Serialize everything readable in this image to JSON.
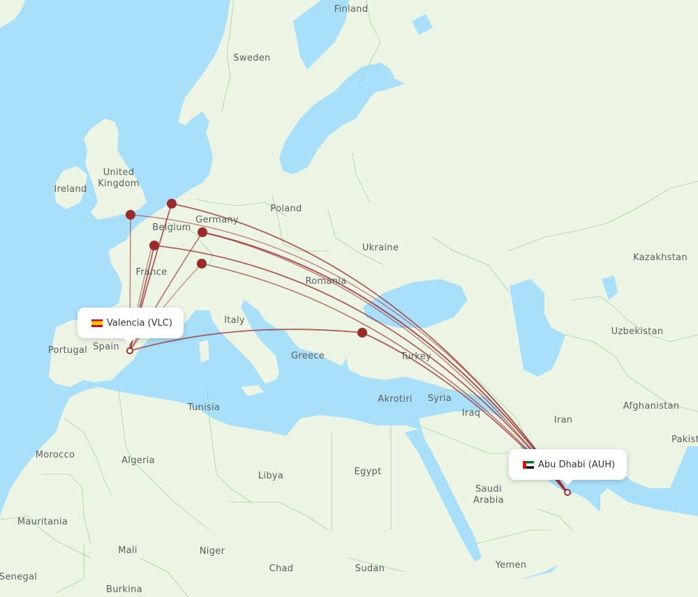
{
  "map": {
    "colors": {
      "water": "#a8dff9",
      "land": "#ecf5e4",
      "border": "#9fd39a",
      "route": "#9c2a2a",
      "hub": "#9c2a2a",
      "label": "#5b5e60"
    },
    "country_labels": [
      {
        "id": "finland",
        "text": "Finland"
      },
      {
        "id": "sweden",
        "text": "Sweden"
      },
      {
        "id": "united-kingdom",
        "text": "United\nKingdom"
      },
      {
        "id": "ireland",
        "text": "Ireland"
      },
      {
        "id": "poland",
        "text": "Poland"
      },
      {
        "id": "belgium",
        "text": "Belgium"
      },
      {
        "id": "germany",
        "text": "Germany"
      },
      {
        "id": "ukraine",
        "text": "Ukraine"
      },
      {
        "id": "kazakhstan",
        "text": "Kazakhstan"
      },
      {
        "id": "france",
        "text": "France"
      },
      {
        "id": "romania",
        "text": "Romania"
      },
      {
        "id": "italy",
        "text": "Italy"
      },
      {
        "id": "portugal",
        "text": "Portugal"
      },
      {
        "id": "spain",
        "text": "Spain"
      },
      {
        "id": "greece",
        "text": "Greece"
      },
      {
        "id": "turkey",
        "text": "Turkey"
      },
      {
        "id": "uzbekistan",
        "text": "Uzbekistan"
      },
      {
        "id": "akrotiri",
        "text": "Akrotiri"
      },
      {
        "id": "syria",
        "text": "Syria"
      },
      {
        "id": "tunisia",
        "text": "Tunisia"
      },
      {
        "id": "iraq",
        "text": "Iraq"
      },
      {
        "id": "afghanistan",
        "text": "Afghanistan"
      },
      {
        "id": "iran",
        "text": "Iran"
      },
      {
        "id": "pakistan",
        "text": "Pakist"
      },
      {
        "id": "morocco",
        "text": "Morocco"
      },
      {
        "id": "algeria",
        "text": "Algeria"
      },
      {
        "id": "libya",
        "text": "Libya"
      },
      {
        "id": "egypt",
        "text": "Egypt"
      },
      {
        "id": "saudi-arabia",
        "text": "Saudi\nArabia"
      },
      {
        "id": "mauritania",
        "text": "Mauritania"
      },
      {
        "id": "mali",
        "text": "Mali"
      },
      {
        "id": "niger",
        "text": "Niger"
      },
      {
        "id": "chad",
        "text": "Chad"
      },
      {
        "id": "sudan",
        "text": "Sudan"
      },
      {
        "id": "yemen",
        "text": "Yemen"
      },
      {
        "id": "senegal",
        "text": "Senegal"
      },
      {
        "id": "burkina",
        "text": "Burkina"
      }
    ],
    "origin": {
      "name": "Valencia (VLC)",
      "flag": "spain-flag-icon"
    },
    "destination": {
      "name": "Abu Dhabi (AUH)",
      "flag": "uae-flag-icon"
    },
    "connection_hubs": [
      {
        "id": "hub-london"
      },
      {
        "id": "hub-amsterdam"
      },
      {
        "id": "hub-paris"
      },
      {
        "id": "hub-frankfurt"
      },
      {
        "id": "hub-zurich"
      },
      {
        "id": "hub-istanbul"
      }
    ]
  }
}
